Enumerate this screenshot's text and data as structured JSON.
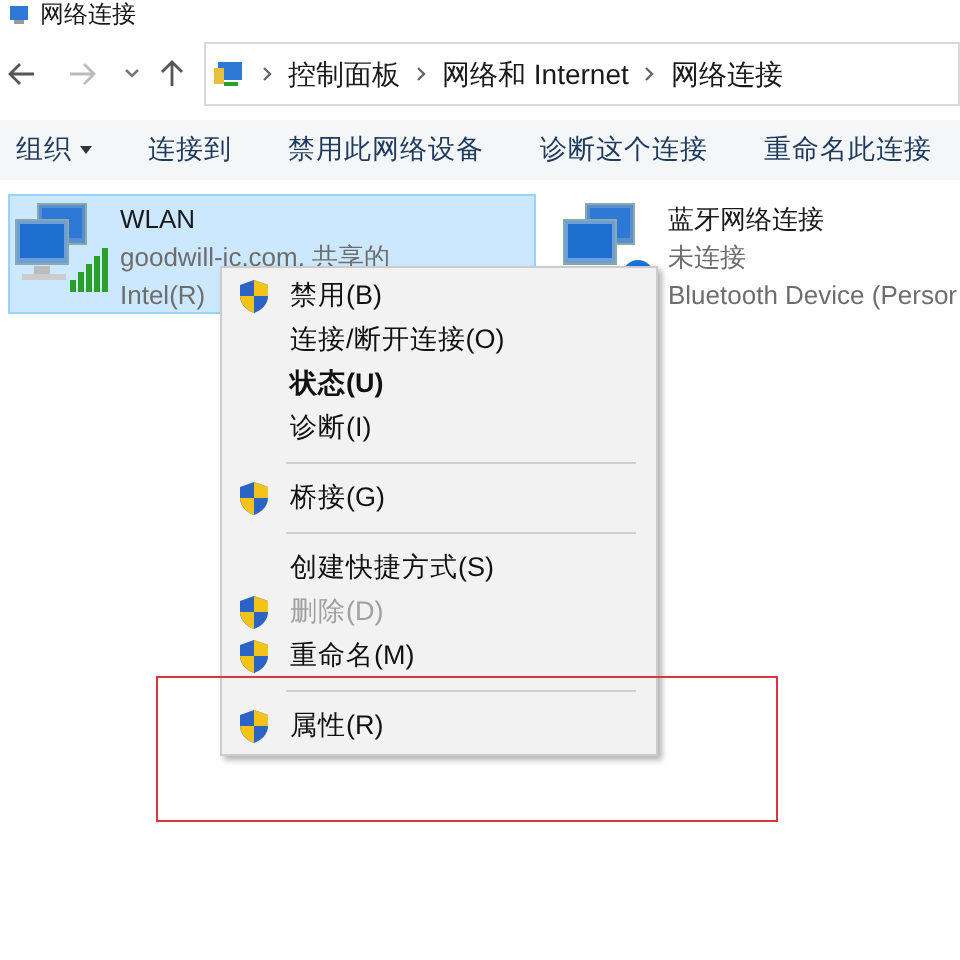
{
  "window": {
    "title": "网络连接"
  },
  "path": [
    "控制面板",
    "网络和 Internet",
    "网络连接"
  ],
  "toolbar": [
    {
      "label": "组织",
      "dropdown": true
    },
    {
      "label": "连接到",
      "dropdown": false
    },
    {
      "label": "禁用此网络设备",
      "dropdown": false
    },
    {
      "label": "诊断这个连接",
      "dropdown": false
    },
    {
      "label": "重命名此连接",
      "dropdown": false
    }
  ],
  "connections": [
    {
      "kind": "wifi",
      "name": "WLAN",
      "status": "goodwill-ic.com, 共享的",
      "device": "Intel(R)",
      "selected": true
    },
    {
      "kind": "bluetooth",
      "name": "蓝牙网络连接",
      "status": "未连接",
      "device": "Bluetooth Device (Persor",
      "selected": false
    }
  ],
  "context_menu": [
    {
      "kind": "item",
      "label": "禁用(B)",
      "shield": true,
      "bold": false,
      "disabled": false
    },
    {
      "kind": "item",
      "label": "连接/断开连接(O)",
      "shield": false,
      "bold": false,
      "disabled": false
    },
    {
      "kind": "item",
      "label": "状态(U)",
      "shield": false,
      "bold": true,
      "disabled": false
    },
    {
      "kind": "item",
      "label": "诊断(I)",
      "shield": false,
      "bold": false,
      "disabled": false
    },
    {
      "kind": "separator"
    },
    {
      "kind": "item",
      "label": "桥接(G)",
      "shield": true,
      "bold": false,
      "disabled": false
    },
    {
      "kind": "separator"
    },
    {
      "kind": "item",
      "label": "创建快捷方式(S)",
      "shield": false,
      "bold": false,
      "disabled": false
    },
    {
      "kind": "item",
      "label": "删除(D)",
      "shield": true,
      "bold": false,
      "disabled": true
    },
    {
      "kind": "item",
      "label": "重命名(M)",
      "shield": true,
      "bold": false,
      "disabled": false
    },
    {
      "kind": "separator"
    },
    {
      "kind": "item",
      "label": "属性(R)",
      "shield": true,
      "bold": false,
      "disabled": false
    }
  ]
}
